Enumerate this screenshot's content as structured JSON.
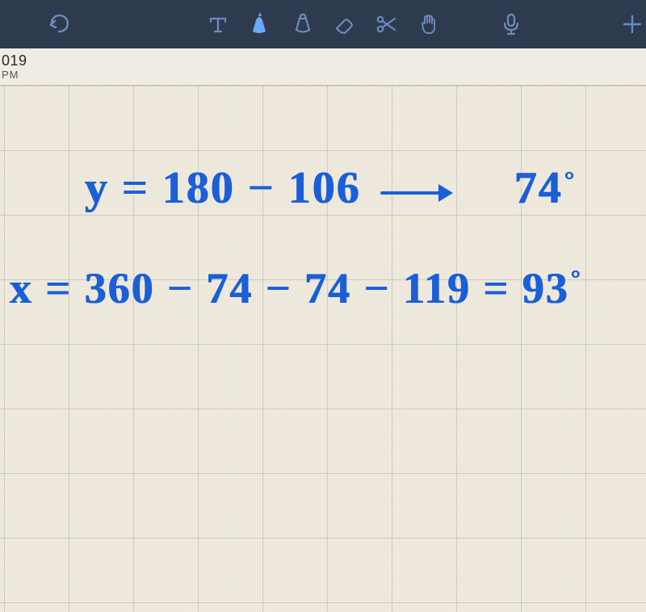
{
  "date": {
    "line1": "019",
    "line2": "PM"
  },
  "handwriting": {
    "line1_a": "y = 180 − 106",
    "line1_b": "74",
    "line1_deg": "°",
    "line2": "x = 360 − 74 − 74 − 119 = 93",
    "line2_deg": "°"
  },
  "colors": {
    "toolbar": "#2e3b4e",
    "icon_inactive": "#6b8bbf",
    "icon_active": "#6aa9ff",
    "ink": "#1a5fd8",
    "paper": "#efeadd"
  },
  "tools": {
    "undo": "undo",
    "text": "text",
    "pen": "pen",
    "highlighter": "highlighter",
    "eraser": "eraser",
    "scissors": "scissors",
    "lasso": "lasso-hand",
    "mic": "microphone",
    "add": "add"
  }
}
